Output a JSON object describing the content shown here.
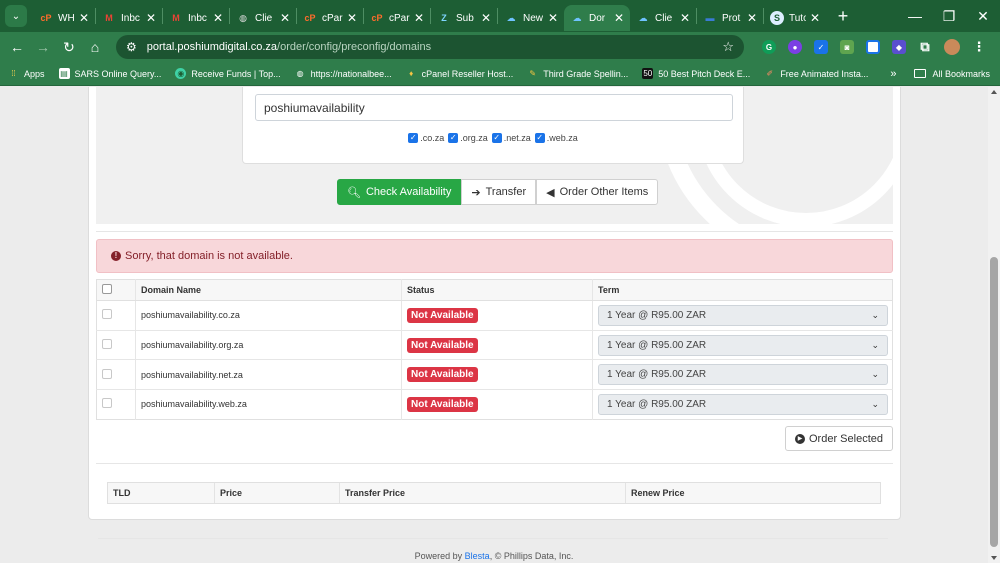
{
  "browser": {
    "tabs": [
      {
        "title": "WH",
        "icon": "cpanel-icon",
        "active": false
      },
      {
        "title": "Inbc",
        "icon": "gmail-icon",
        "active": false
      },
      {
        "title": "Inbc",
        "icon": "gmail-icon",
        "active": false
      },
      {
        "title": "Clie",
        "icon": "globe-icon",
        "active": false
      },
      {
        "title": "cPar",
        "icon": "cpanel-icon",
        "active": false
      },
      {
        "title": "cPar",
        "icon": "cpanel-icon",
        "active": false
      },
      {
        "title": "Sub",
        "icon": "zendesk-icon",
        "active": false
      },
      {
        "title": "New",
        "icon": "cloud-icon",
        "active": false
      },
      {
        "title": "Dor",
        "icon": "cloud-icon",
        "active": true
      },
      {
        "title": "Clie",
        "icon": "cloud-icon",
        "active": false
      },
      {
        "title": "Prot",
        "icon": "dash-icon",
        "active": false
      },
      {
        "title": "Tuto",
        "icon": "s-icon",
        "active": false
      }
    ],
    "url_domain": "portal.poshiumdigital.co.za",
    "url_path": "/order/config/preconfig/domains",
    "bookmarks": [
      {
        "label": "Apps",
        "icon": "apps-grid-icon"
      },
      {
        "label": "SARS Online Query...",
        "icon": "document-icon"
      },
      {
        "label": "Receive Funds | Top...",
        "icon": "funds-icon"
      },
      {
        "label": "https://nationalbee...",
        "icon": "globe-icon"
      },
      {
        "label": "cPanel Reseller Host...",
        "icon": "badge-icon"
      },
      {
        "label": "Third Grade Spellin...",
        "icon": "spelling-icon"
      },
      {
        "label": "50 Best Pitch Deck E...",
        "icon": "pitch-icon"
      },
      {
        "label": "Free Animated Insta...",
        "icon": "pen-icon"
      }
    ],
    "bookmarks_more": "»",
    "all_bookmarks": "All Bookmarks"
  },
  "search": {
    "query": "poshiumavailability",
    "tlds": [
      {
        "label": ".co.za",
        "checked": true
      },
      {
        "label": ".org.za",
        "checked": true
      },
      {
        "label": ".net.za",
        "checked": true
      },
      {
        "label": ".web.za",
        "checked": true
      }
    ],
    "buttons": {
      "check": "Check Availability",
      "transfer": "Transfer",
      "order_other": "Order Other Items"
    }
  },
  "alert": {
    "message": "Sorry, that domain is not available."
  },
  "results": {
    "headers": {
      "domain": "Domain Name",
      "status": "Status",
      "term": "Term"
    },
    "rows": [
      {
        "domain": "poshiumavailability.co.za",
        "status": "Not Available",
        "term": "1 Year @ R95.00 ZAR"
      },
      {
        "domain": "poshiumavailability.org.za",
        "status": "Not Available",
        "term": "1 Year @ R95.00 ZAR"
      },
      {
        "domain": "poshiumavailability.net.za",
        "status": "Not Available",
        "term": "1 Year @ R95.00 ZAR"
      },
      {
        "domain": "poshiumavailability.web.za",
        "status": "Not Available",
        "term": "1 Year @ R95.00 ZAR"
      }
    ],
    "order_button": "Order Selected"
  },
  "pricing": {
    "headers": [
      "TLD",
      "Price",
      "Transfer Price",
      "Renew Price"
    ]
  },
  "footer": {
    "prefix": "Powered by ",
    "link": "Blesta",
    "suffix": ", © Phillips Data, Inc."
  },
  "colors": {
    "chrome": "#2f7d4b",
    "primary_button": "#28a745",
    "danger_badge": "#dc3545",
    "alert_bg": "#f8d7da"
  }
}
